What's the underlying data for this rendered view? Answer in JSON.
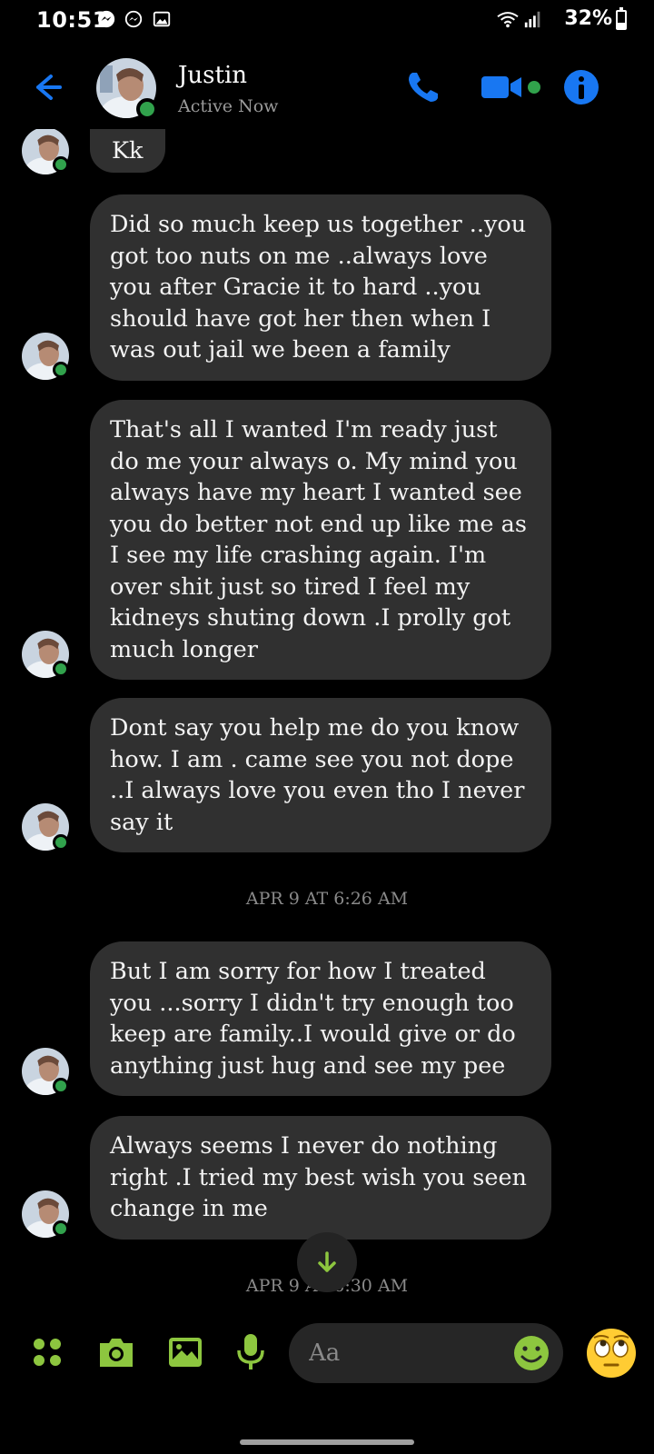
{
  "status_bar": {
    "time": "10:51",
    "battery": "32%",
    "battery_level": 0.32,
    "icons": [
      "messenger-icon",
      "messenger-icon",
      "gallery-icon",
      "wifi-icon",
      "signal-icon",
      "battery-icon"
    ]
  },
  "header": {
    "name": "Justin",
    "status": "Active Now",
    "accent": "#1877f2",
    "online_color": "#31a24c"
  },
  "messages": [
    {
      "text": "Kk"
    },
    {
      "text": "Did so much keep us together  ..you got too nuts on me ..always love you after Gracie it to hard  ..you should have got her then when I was out jail we been a family"
    },
    {
      "text": "That's all I wanted I'm ready   just do me your always o. My mind you always have my heart I wanted see you do better not end up like me  as I see my life crashing  again. I'm over shit just so tired I feel my kidneys shuting down .I prolly got much longer"
    },
    {
      "text": "Dont say you help me do you know how. I am . came see you not dope ..I always love you even tho I never say it"
    },
    {
      "text": "But I am sorry for how I treated you ...sorry I didn't  try enough  too keep are family..I would give or do anything  just hug and  see my pee"
    },
    {
      "text": "Always seems I never do nothing right .I tried my best wish you seen change in me"
    }
  ],
  "timestamps": [
    "APR 9 AT 6:26 AM",
    "APR 9 AT 6:30 AM"
  ],
  "composer": {
    "placeholder": "Aa",
    "accent": "#8dc63f"
  }
}
